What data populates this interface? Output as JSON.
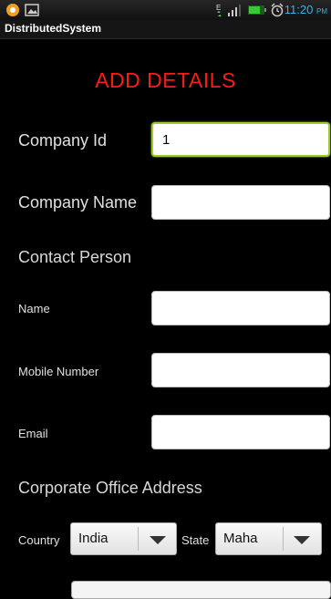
{
  "status_bar": {
    "time": "11:20",
    "ampm": "PM",
    "network_letter": "E"
  },
  "app": {
    "title": "DistributedSystem"
  },
  "form": {
    "heading": "ADD DETAILS",
    "company_id": {
      "label": "Company Id",
      "value": "1"
    },
    "company_name": {
      "label": "Company Name",
      "value": ""
    },
    "contact_section": "Contact Person",
    "name": {
      "label": "Name",
      "value": ""
    },
    "mobile": {
      "label": "Mobile Number",
      "value": ""
    },
    "email": {
      "label": "Email",
      "value": ""
    },
    "address_section": "Corporate Office Address",
    "country": {
      "label": "Country",
      "selected": "India"
    },
    "state": {
      "label": "State",
      "selected": "Maha"
    }
  },
  "colors": {
    "heading": "#ff1a1a",
    "focus": "#9ccc2a",
    "clock": "#33b5e5"
  }
}
